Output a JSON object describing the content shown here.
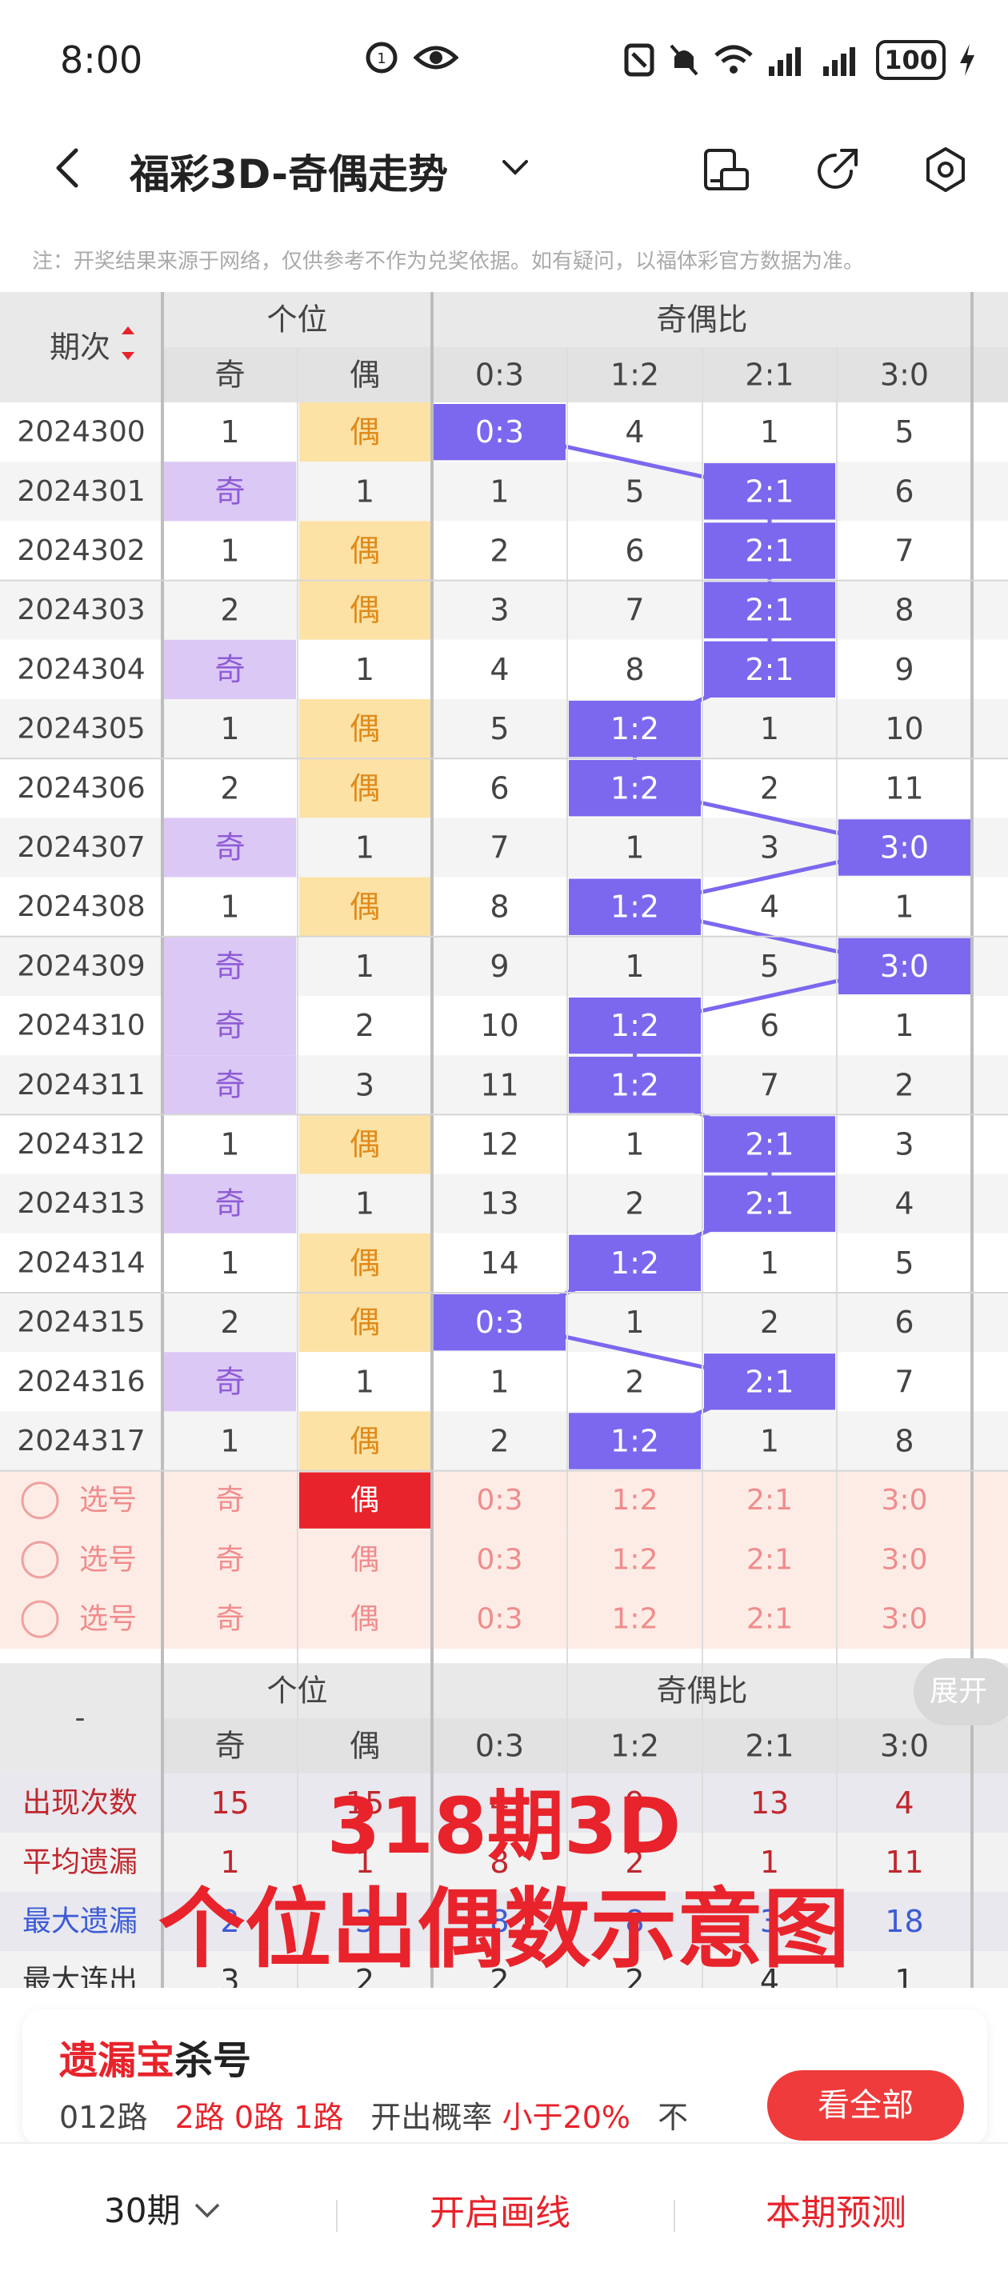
{
  "status": {
    "time": "8:00",
    "battery": "100"
  },
  "header": {
    "title": "福彩3D-奇偶走势"
  },
  "notice": "注：开奖结果来源于网络，仅供参考不作为兑奖依据。如有疑问，以福体彩官方数据为准。",
  "table": {
    "period_label": "期次",
    "group1": "个位",
    "group2": "奇偶比",
    "sub1": [
      "奇",
      "偶"
    ],
    "sub2": [
      "0:3",
      "1:2",
      "2:1",
      "3:0"
    ],
    "rows": [
      {
        "p": "2024300",
        "odd": "1",
        "even": "偶",
        "hit1": "even",
        "r": [
          "0:3",
          "4",
          "1",
          "5"
        ],
        "hit2": 0
      },
      {
        "p": "2024301",
        "odd": "奇",
        "even": "1",
        "hit1": "odd",
        "r": [
          "1",
          "5",
          "2:1",
          "6"
        ],
        "hit2": 2
      },
      {
        "p": "2024302",
        "odd": "1",
        "even": "偶",
        "hit1": "even",
        "r": [
          "2",
          "6",
          "2:1",
          "7"
        ],
        "hit2": 2
      },
      {
        "p": "2024303",
        "odd": "2",
        "even": "偶",
        "hit1": "even",
        "r": [
          "3",
          "7",
          "2:1",
          "8"
        ],
        "hit2": 2
      },
      {
        "p": "2024304",
        "odd": "奇",
        "even": "1",
        "hit1": "odd",
        "r": [
          "4",
          "8",
          "2:1",
          "9"
        ],
        "hit2": 2
      },
      {
        "p": "2024305",
        "odd": "1",
        "even": "偶",
        "hit1": "even",
        "r": [
          "5",
          "1:2",
          "1",
          "10"
        ],
        "hit2": 1
      },
      {
        "p": "2024306",
        "odd": "2",
        "even": "偶",
        "hit1": "even",
        "r": [
          "6",
          "1:2",
          "2",
          "11"
        ],
        "hit2": 1
      },
      {
        "p": "2024307",
        "odd": "奇",
        "even": "1",
        "hit1": "odd",
        "r": [
          "7",
          "1",
          "3",
          "3:0"
        ],
        "hit2": 3
      },
      {
        "p": "2024308",
        "odd": "1",
        "even": "偶",
        "hit1": "even",
        "r": [
          "8",
          "1:2",
          "4",
          "1"
        ],
        "hit2": 1
      },
      {
        "p": "2024309",
        "odd": "奇",
        "even": "1",
        "hit1": "odd",
        "r": [
          "9",
          "1",
          "5",
          "3:0"
        ],
        "hit2": 3
      },
      {
        "p": "2024310",
        "odd": "奇",
        "even": "2",
        "hit1": "odd",
        "r": [
          "10",
          "1:2",
          "6",
          "1"
        ],
        "hit2": 1
      },
      {
        "p": "2024311",
        "odd": "奇",
        "even": "3",
        "hit1": "odd",
        "r": [
          "11",
          "1:2",
          "7",
          "2"
        ],
        "hit2": 1
      },
      {
        "p": "2024312",
        "odd": "1",
        "even": "偶",
        "hit1": "even",
        "r": [
          "12",
          "1",
          "2:1",
          "3"
        ],
        "hit2": 2
      },
      {
        "p": "2024313",
        "odd": "奇",
        "even": "1",
        "hit1": "odd",
        "r": [
          "13",
          "2",
          "2:1",
          "4"
        ],
        "hit2": 2
      },
      {
        "p": "2024314",
        "odd": "1",
        "even": "偶",
        "hit1": "even",
        "r": [
          "14",
          "1:2",
          "1",
          "5"
        ],
        "hit2": 1
      },
      {
        "p": "2024315",
        "odd": "2",
        "even": "偶",
        "hit1": "even",
        "r": [
          "0:3",
          "1",
          "2",
          "6"
        ],
        "hit2": 0
      },
      {
        "p": "2024316",
        "odd": "奇",
        "even": "1",
        "hit1": "odd",
        "r": [
          "1",
          "2",
          "2:1",
          "7"
        ],
        "hit2": 2
      },
      {
        "p": "2024317",
        "odd": "1",
        "even": "偶",
        "hit1": "even",
        "r": [
          "2",
          "1:2",
          "1",
          "8"
        ],
        "hit2": 1
      }
    ],
    "select_label": "选号",
    "select_rows": 3,
    "stats_dash": "-",
    "stats": [
      {
        "label": "出现次数",
        "color": "#c0272d",
        "vals": [
          "15",
          "15",
          "4",
          "9",
          "13",
          "4"
        ]
      },
      {
        "label": "平均遗漏",
        "color": "#c0272d",
        "vals": [
          "1",
          "1",
          "8",
          "2",
          "1",
          "11"
        ]
      },
      {
        "label": "最大遗漏",
        "color": "#3d5bd6",
        "vals": [
          "2",
          "3",
          "8",
          "8",
          "3",
          "18"
        ]
      },
      {
        "label": "最大连出",
        "color": "#333333",
        "vals": [
          "3",
          "2",
          "2",
          "2",
          "4",
          "1"
        ]
      }
    ],
    "expand": "展开"
  },
  "overlay": {
    "line1": "318期3D",
    "line2": "个位出偶数示意图"
  },
  "kill": {
    "title_red": "遗漏宝",
    "title_black": "杀号",
    "route": "012路",
    "routes": "2路 0路 1路",
    "prob_label": "开出概率",
    "prob_value": "小于20%",
    "tail": "不",
    "btn": "看全部"
  },
  "footer": {
    "periods": "30期",
    "draw": "开启画线",
    "predict": "本期预测"
  },
  "colors": {
    "accent": "#7b68ee",
    "odd_bg": "#dcc8f5",
    "odd_text": "#8e5cd6",
    "even_bg": "#fde2a6",
    "even_text": "#e08a1a",
    "red": "#e8232b"
  }
}
